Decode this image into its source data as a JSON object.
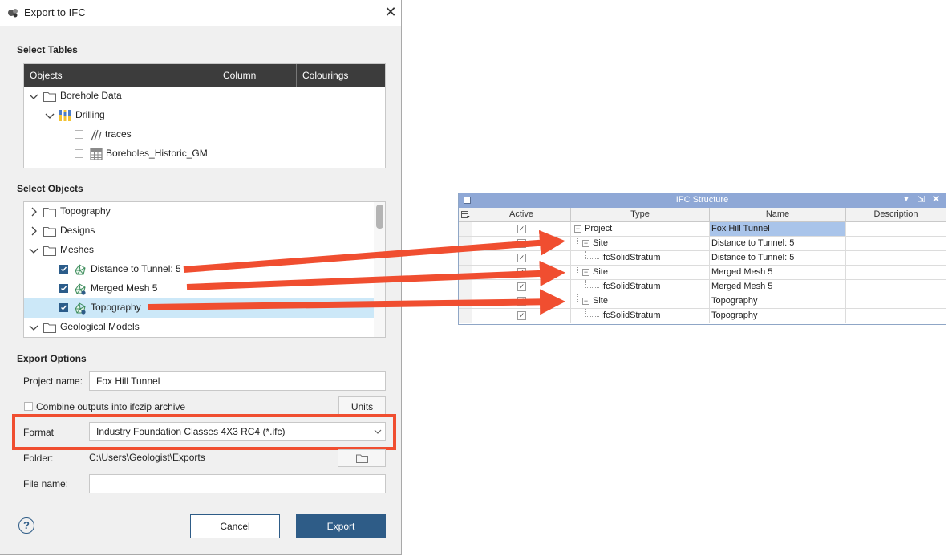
{
  "dialog": {
    "title": "Export to IFC",
    "select_tables": {
      "label": "Select Tables",
      "columns": [
        "Objects",
        "Column",
        "Colourings"
      ],
      "items": [
        {
          "label": "Borehole Data"
        },
        {
          "label": "Drilling"
        },
        {
          "label": "traces",
          "checked": false
        },
        {
          "label": "Boreholes_Historic_GM",
          "checked": false
        }
      ]
    },
    "select_objects": {
      "label": "Select Objects",
      "items": [
        {
          "label": "Topography",
          "expanded": false
        },
        {
          "label": "Designs",
          "expanded": false
        },
        {
          "label": "Meshes",
          "expanded": true
        },
        {
          "label": "Distance to Tunnel: 5",
          "checked": true
        },
        {
          "label": "Merged Mesh 5",
          "checked": true
        },
        {
          "label": "Topography",
          "checked": true,
          "selected": true
        },
        {
          "label": "Geological Models",
          "expanded": true
        }
      ]
    },
    "export_options": {
      "label": "Export Options",
      "project_name_label": "Project name:",
      "project_name_value": "Fox Hill Tunnel",
      "combine_label": "Combine outputs into ifczip archive",
      "combine_checked": false,
      "units_button": "Units",
      "format_label": "Format",
      "format_value": "Industry Foundation Classes 4X3 RC4 (*.ifc)",
      "folder_label": "Folder:",
      "folder_value": "C:\\Users\\Geologist\\Exports",
      "file_name_label": "File name:",
      "file_name_value": ""
    },
    "help_icon": "?",
    "cancel_button": "Cancel",
    "export_button": "Export",
    "accent_color": "#2e5c87",
    "highlight_color": "#f04e30"
  },
  "ifc_structure": {
    "title": "IFC Structure",
    "columns": [
      "Active",
      "Type",
      "Name",
      "Description"
    ],
    "rows": [
      {
        "active": true,
        "type": "Project",
        "name": "Fox Hill Tunnel",
        "description": ""
      },
      {
        "active": true,
        "type": "Site",
        "name": "Distance to Tunnel: 5",
        "description": ""
      },
      {
        "active": true,
        "type": "IfcSolidStratum",
        "name": "Distance to Tunnel: 5",
        "description": ""
      },
      {
        "active": true,
        "type": "Site",
        "name": "Merged Mesh 5",
        "description": ""
      },
      {
        "active": true,
        "type": "IfcSolidStratum",
        "name": "Merged Mesh 5",
        "description": ""
      },
      {
        "active": true,
        "type": "Site",
        "name": "Topography",
        "description": ""
      },
      {
        "active": true,
        "type": "IfcSolidStratum",
        "name": "Topography",
        "description": ""
      }
    ]
  }
}
